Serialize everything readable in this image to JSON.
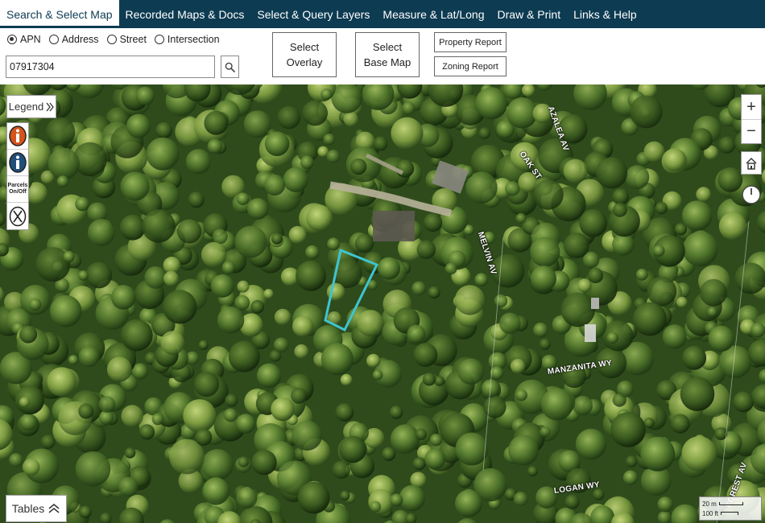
{
  "nav": {
    "tabs": [
      {
        "label": "Search & Select Map",
        "active": true
      },
      {
        "label": "Recorded Maps & Docs",
        "active": false
      },
      {
        "label": "Select & Query Layers",
        "active": false
      },
      {
        "label": "Measure & Lat/Long",
        "active": false
      },
      {
        "label": "Draw & Print",
        "active": false
      },
      {
        "label": "Links & Help",
        "active": false
      }
    ]
  },
  "search": {
    "modes": [
      {
        "label": "APN",
        "checked": true
      },
      {
        "label": "Address",
        "checked": false
      },
      {
        "label": "Street",
        "checked": false
      },
      {
        "label": "Intersection",
        "checked": false
      }
    ],
    "value": "07917304",
    "select_overlay_label": "Select\nOverlay",
    "select_base_map_label": "Select\nBase Map",
    "property_report_label": "Property Report",
    "zoning_report_label": "Zoning Report"
  },
  "map": {
    "legend_label": "Legend",
    "tables_label": "Tables",
    "parcels_toggle_label": "Parcels On/Off",
    "zoom_in_label": "+",
    "zoom_out_label": "−",
    "streets": [
      {
        "name": "AZALEA AV"
      },
      {
        "name": "OAK ST"
      },
      {
        "name": "MELVIN AV"
      },
      {
        "name": "MANZANITA WY"
      },
      {
        "name": "LOGAN WY"
      },
      {
        "name": "FOREST AV"
      }
    ],
    "scale": {
      "top": "20 m",
      "bottom": "100 ft"
    },
    "colors": {
      "parcel_outline": "#3fc4d0",
      "canopy": "#3c6226"
    }
  }
}
